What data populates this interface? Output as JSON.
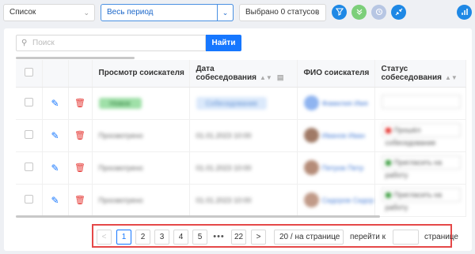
{
  "toolbar": {
    "view_select": "Список",
    "period_select": "Весь период",
    "status_select": "Выбрано 0 статусов",
    "buttons": [
      {
        "name": "filter",
        "icon": "filter-icon"
      },
      {
        "name": "expand",
        "icon": "chevrons-down-icon"
      },
      {
        "name": "reset",
        "icon": "history-icon"
      },
      {
        "name": "collapse",
        "icon": "collapse-icon"
      },
      {
        "name": "chart",
        "icon": "bar-chart-icon"
      }
    ]
  },
  "search": {
    "placeholder": "Поиск",
    "button_label": "Найти"
  },
  "table": {
    "columns": [
      "Просмотр соискателя",
      "Дата собеседования",
      "ФИО соискателя",
      "Статус собеседования"
    ],
    "rows": [
      {
        "view": "Новое",
        "date": "Собеседование",
        "fio": "Фамилия Имя",
        "status": ""
      },
      {
        "view": "Просмотрено",
        "date": "01.01.2023 10:00",
        "fio": "Иванов Иван",
        "status": "Прошёл собеседование"
      },
      {
        "view": "Просмотрено",
        "date": "01.01.2023 10:00",
        "fio": "Петров Петр",
        "status": "Пригласить на работу"
      },
      {
        "view": "Просмотрено",
        "date": "01.01.2023 10:00",
        "fio": "Сидоров Сидор",
        "status": "Пригласить на работу"
      }
    ]
  },
  "pagination": {
    "prev": "<",
    "next": ">",
    "pages": [
      "1",
      "2",
      "3",
      "4",
      "5"
    ],
    "ellipsis": "•••",
    "last": "22",
    "current": "1",
    "page_size": "20 / на странице",
    "goto_label": "перейти к",
    "goto_suffix": "странице"
  },
  "colors": {
    "accent": "#1677ff",
    "highlight_border": "#e54848"
  }
}
